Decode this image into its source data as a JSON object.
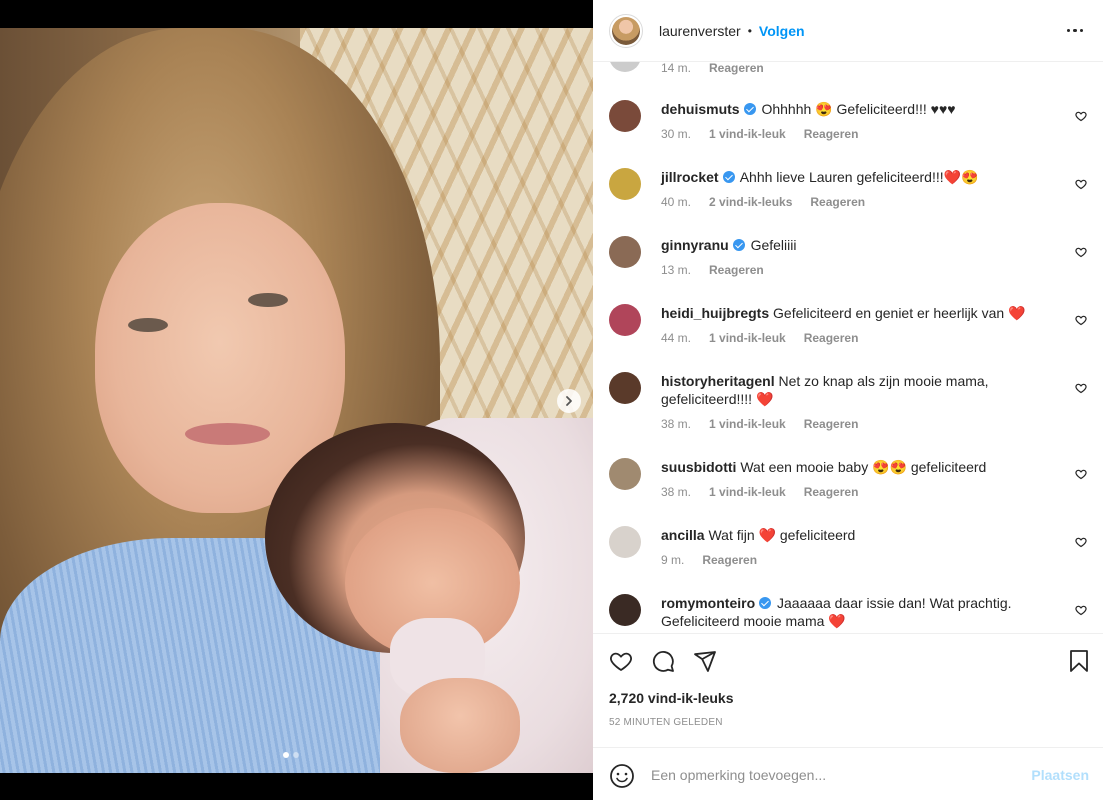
{
  "post": {
    "author": "laurenverster",
    "follow_label": "Volgen",
    "separator": "•",
    "likes": "2,720 vind-ik-leuks",
    "posted": "52 MINUTEN GELEDEN",
    "carousel": {
      "slides": 2,
      "active": 0
    }
  },
  "comments": {
    "partial": {
      "time": "14 m.",
      "reply": "Reageren"
    },
    "items": [
      {
        "user": "dehuismuts",
        "verified": true,
        "text": "Ohhhhh 😍 Gefeliciteerd!!! ♥♥♥",
        "time": "30 m.",
        "likes": "1 vind-ik-leuk",
        "reply": "Reageren",
        "avatar_color": "#7a4a3a"
      },
      {
        "user": "jillrocket",
        "verified": true,
        "text": "Ahhh lieve Lauren gefeliciteerd!!!❤️😍",
        "time": "40 m.",
        "likes": "2 vind-ik-leuks",
        "reply": "Reageren",
        "avatar_color": "#c9a640"
      },
      {
        "user": "ginnyranu",
        "verified": true,
        "text": "Gefeliiii",
        "time": "13 m.",
        "likes": "",
        "reply": "Reageren",
        "avatar_color": "#8a6a55"
      },
      {
        "user": "heidi_huijbregts",
        "verified": false,
        "text": "Gefeliciteerd en geniet er heerlijk van ❤️",
        "time": "44 m.",
        "likes": "1 vind-ik-leuk",
        "reply": "Reageren",
        "avatar_color": "#b0455a"
      },
      {
        "user": "historyheritagenl",
        "verified": false,
        "text": "Net zo knap als zijn mooie mama, gefeliciteerd!!!! ❤️",
        "time": "38 m.",
        "likes": "1 vind-ik-leuk",
        "reply": "Reageren",
        "avatar_color": "#5a3a2a"
      },
      {
        "user": "suusbidotti",
        "verified": false,
        "text": "Wat een mooie baby 😍😍 gefeliciteerd",
        "time": "38 m.",
        "likes": "1 vind-ik-leuk",
        "reply": "Reageren",
        "avatar_color": "#a08a70"
      },
      {
        "user": "ancilla",
        "verified": false,
        "text": "Wat fijn ❤️ gefeliciteerd",
        "time": "9 m.",
        "likes": "",
        "reply": "Reageren",
        "avatar_color": "#d8d2cc"
      },
      {
        "user": "romymonteiro",
        "verified": true,
        "text": "Jaaaaaa daar issie dan! Wat prachtig. Gefeliciteerd mooie mama ❤️",
        "time": "",
        "likes": "",
        "reply": "",
        "avatar_color": "#3a2a24"
      }
    ]
  },
  "add_comment": {
    "placeholder": "Een opmerking toevoegen...",
    "post_label": "Plaatsen"
  },
  "icons": [
    "chevron-right-icon",
    "more-icon",
    "verified-icon",
    "heart-icon",
    "comment-icon",
    "share-icon",
    "bookmark-icon",
    "smile-icon"
  ],
  "colors": {
    "link": "#0095f6",
    "verified": "#3897f0",
    "muted": "#8e8e8e",
    "post_disabled": "#b2dffc"
  }
}
